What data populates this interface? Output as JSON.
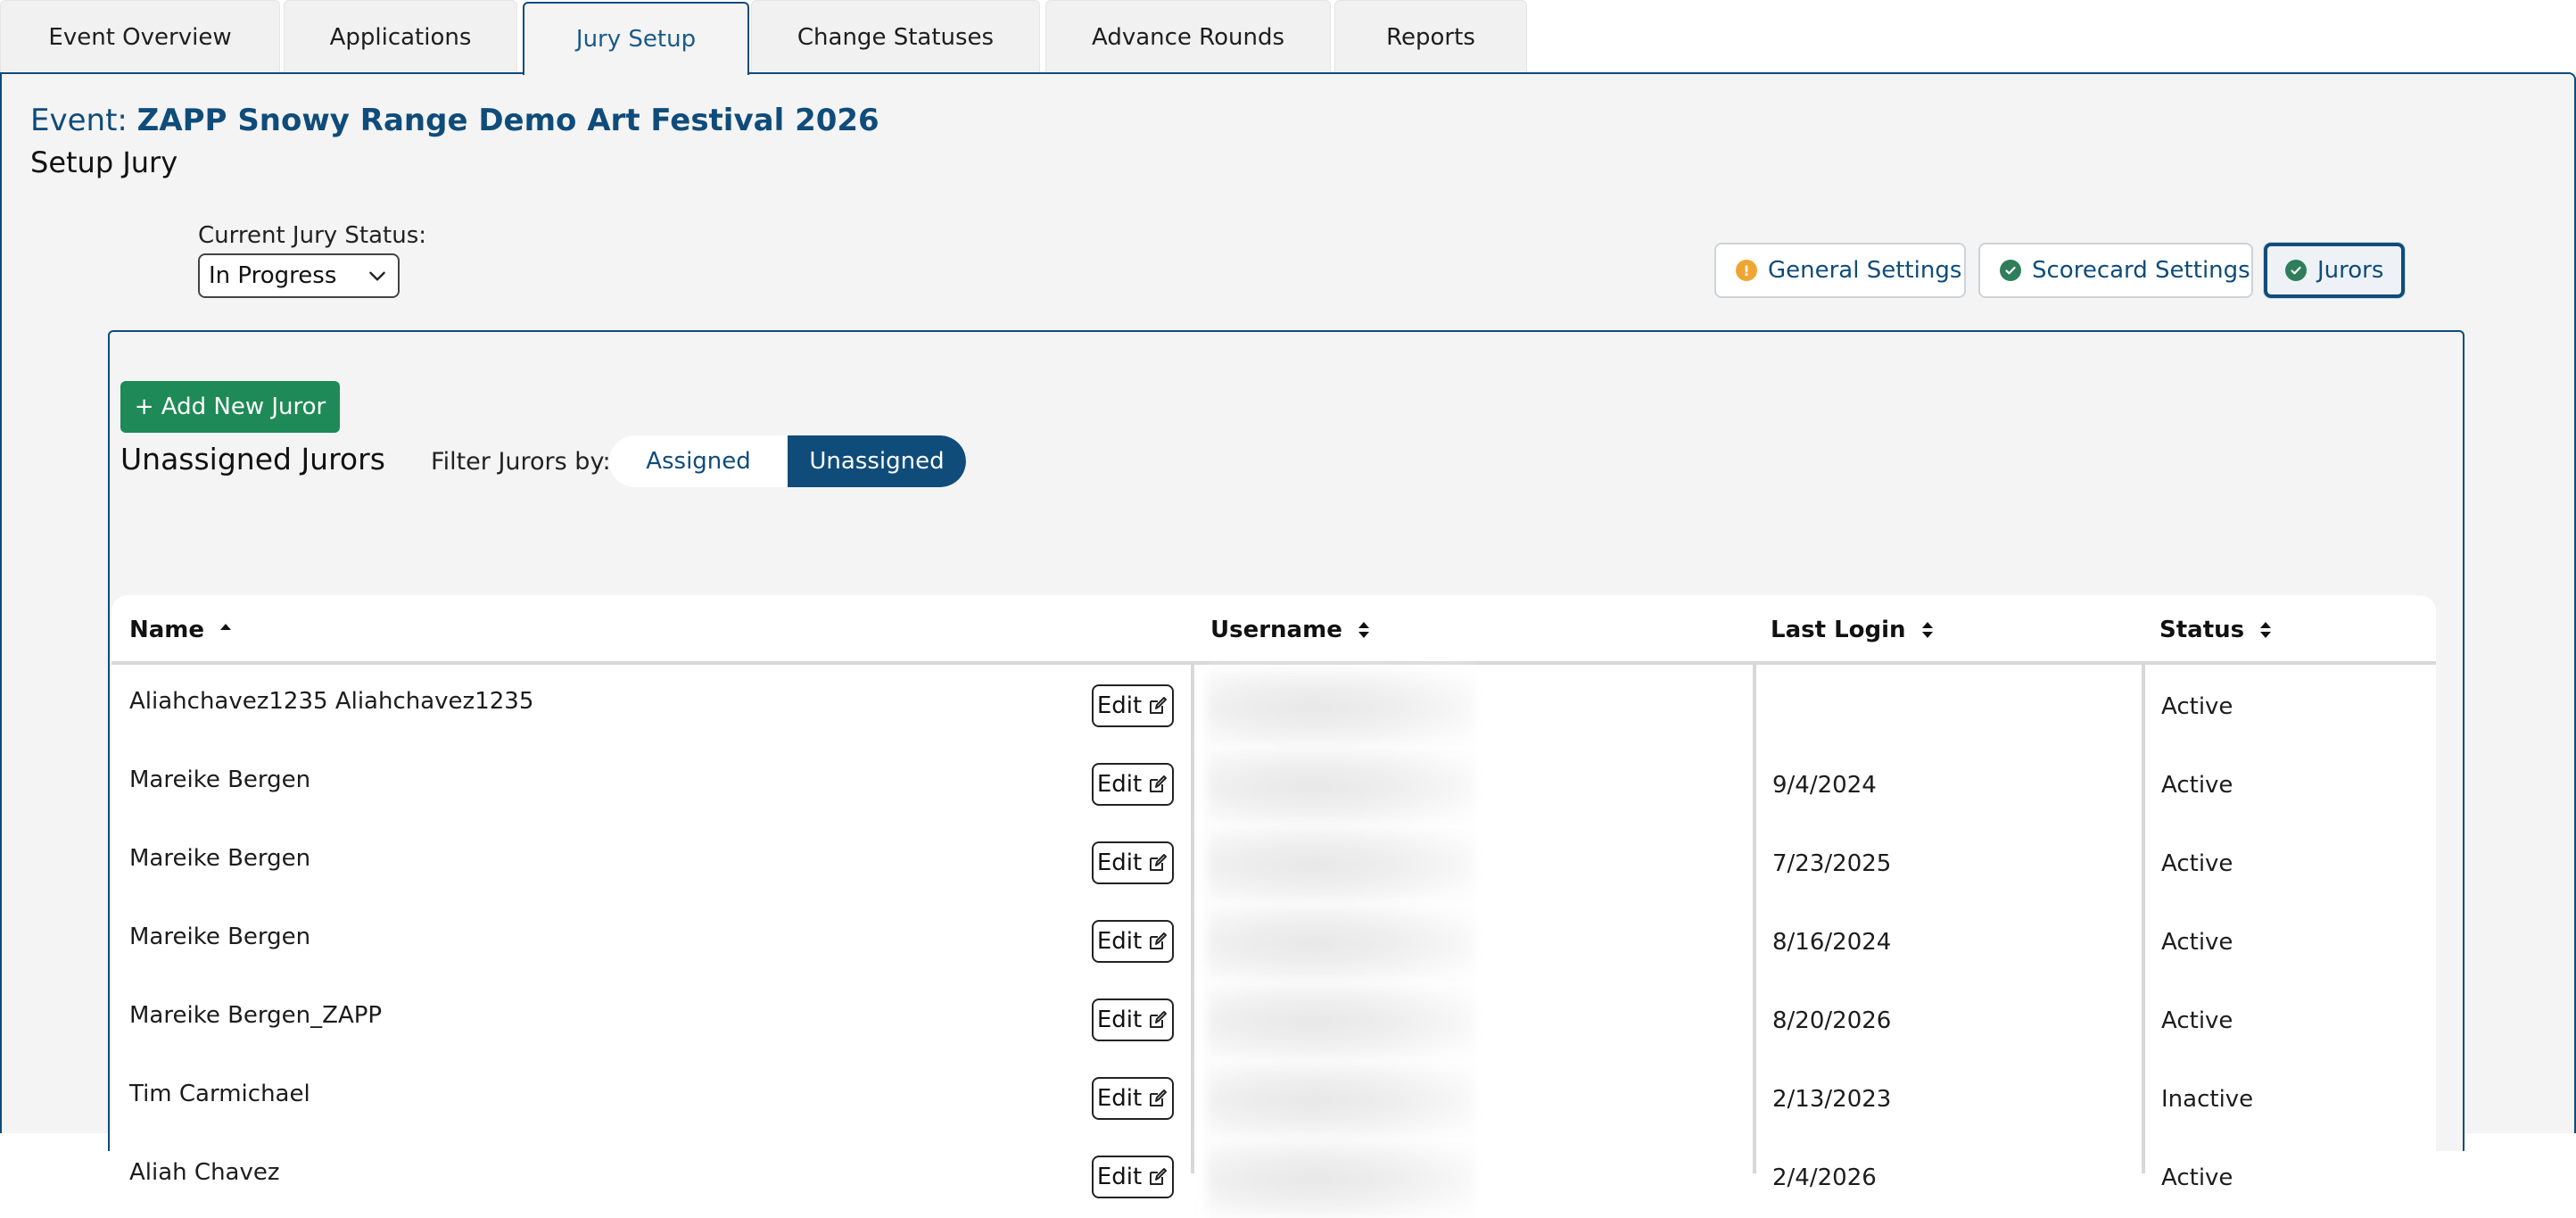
{
  "tabs": [
    {
      "label": "Event Overview"
    },
    {
      "label": "Applications"
    },
    {
      "label": "Jury Setup"
    },
    {
      "label": "Change Statuses"
    },
    {
      "label": "Advance Rounds"
    },
    {
      "label": "Reports"
    }
  ],
  "active_tab": "Jury Setup",
  "event": {
    "prefix": "Event:",
    "name": "ZAPP Snowy Range Demo Art Festival 2026"
  },
  "page_title": "Setup Jury",
  "jury_status": {
    "label": "Current Jury Status:",
    "value": "In Progress"
  },
  "settings_buttons": [
    {
      "label": "General Settings",
      "state": "warning",
      "icon": "warning-icon"
    },
    {
      "label": "Scorecard Settings",
      "state": "complete",
      "icon": "check-icon"
    },
    {
      "label": "Jurors",
      "state": "complete",
      "icon": "check-icon",
      "active": true
    }
  ],
  "add_juror_label": "+ Add New Juror",
  "section_heading": "Unassigned Jurors",
  "filter": {
    "label": "Filter Jurors by:",
    "options": [
      "Assigned",
      "Unassigned"
    ],
    "selected": "Unassigned"
  },
  "table": {
    "columns": [
      "Name",
      "Username",
      "Last Login",
      "Status"
    ],
    "sort": {
      "column": "Name",
      "direction": "ascending"
    },
    "edit_label": "Edit",
    "rows": [
      {
        "name": "Aliahchavez1235 Aliahchavez1235",
        "last_login": "",
        "status": "Active"
      },
      {
        "name": "Mareike Bergen",
        "last_login": "9/4/2024",
        "status": "Active"
      },
      {
        "name": "Mareike Bergen",
        "last_login": "7/23/2025",
        "status": "Active"
      },
      {
        "name": "Mareike Bergen",
        "last_login": "8/16/2024",
        "status": "Active"
      },
      {
        "name": "Mareike Bergen_ZAPP",
        "last_login": "8/20/2026",
        "status": "Active"
      },
      {
        "name": "Tim Carmichael",
        "last_login": "2/13/2023",
        "status": "Inactive"
      },
      {
        "name": "Aliah Chavez",
        "last_login": "2/4/2026",
        "status": "Active"
      }
    ]
  },
  "colors": {
    "brand_blue": "#0f4c7a",
    "add_green": "#1e8a57",
    "warning_orange": "#f0a532",
    "complete_green": "#2f7d5a"
  }
}
